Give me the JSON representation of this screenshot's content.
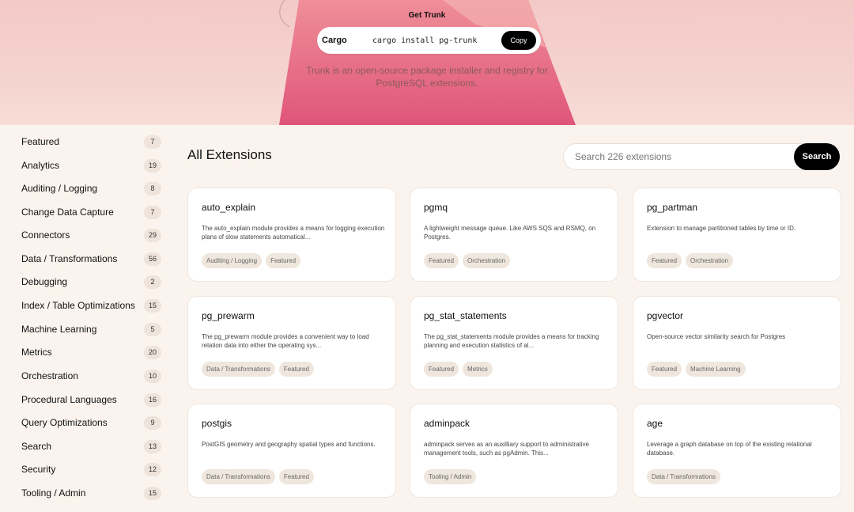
{
  "hero": {
    "heading": "Get Trunk",
    "package_manager": "Cargo",
    "command": "cargo install pg-trunk",
    "copy_label": "Copy",
    "tagline_line1": "Trunk is an open-source package installer and registry for",
    "tagline_line2": "PostgreSQL extensions."
  },
  "sidebar": {
    "categories": [
      {
        "label": "Featured",
        "count": "7"
      },
      {
        "label": "Analytics",
        "count": "19"
      },
      {
        "label": "Auditing / Logging",
        "count": "8"
      },
      {
        "label": "Change Data Capture",
        "count": "7"
      },
      {
        "label": "Connectors",
        "count": "29"
      },
      {
        "label": "Data / Transformations",
        "count": "56"
      },
      {
        "label": "Debugging",
        "count": "2"
      },
      {
        "label": "Index / Table Optimizations",
        "count": "15"
      },
      {
        "label": "Machine Learning",
        "count": "5"
      },
      {
        "label": "Metrics",
        "count": "20"
      },
      {
        "label": "Orchestration",
        "count": "10"
      },
      {
        "label": "Procedural Languages",
        "count": "16"
      },
      {
        "label": "Query Optimizations",
        "count": "9"
      },
      {
        "label": "Search",
        "count": "13"
      },
      {
        "label": "Security",
        "count": "12"
      },
      {
        "label": "Tooling / Admin",
        "count": "15"
      }
    ]
  },
  "main": {
    "title": "All Extensions",
    "search_placeholder": "Search 226 extensions",
    "search_button": "Search",
    "extensions": [
      {
        "name": "auto_explain",
        "description": "The auto_explain module provides a means for logging execution plans of slow statements automatical...",
        "tags": [
          "Auditing / Logging",
          "Featured"
        ]
      },
      {
        "name": "pgmq",
        "description": "A lightweight message queue. Like AWS SQS and RSMQ, on Postgres.",
        "tags": [
          "Featured",
          "Orchestration"
        ]
      },
      {
        "name": "pg_partman",
        "description": "Extension to manage partitioned tables by time or ID.",
        "tags": [
          "Featured",
          "Orchestration"
        ]
      },
      {
        "name": "pg_prewarm",
        "description": "The pg_prewarm module provides a convenient way to load relation data into either the operating sys...",
        "tags": [
          "Data / Transformations",
          "Featured"
        ]
      },
      {
        "name": "pg_stat_statements",
        "description": "The pg_stat_statements module provides a means for tracking planning and execution statistics of al...",
        "tags": [
          "Featured",
          "Metrics"
        ]
      },
      {
        "name": "pgvector",
        "description": "Open-source vector similarity search for Postgres",
        "tags": [
          "Featured",
          "Machine Learning"
        ]
      },
      {
        "name": "postgis",
        "description": "PostGIS geometry and geography spatial types and functions.",
        "tags": [
          "Data / Transformations",
          "Featured"
        ]
      },
      {
        "name": "adminpack",
        "description": "adminpack serves as an auxilliary support to administrative management tools, such as pgAdmin. This...",
        "tags": [
          "Tooling / Admin"
        ]
      },
      {
        "name": "age",
        "description": "Leverage a graph database on top of the existing relational database.",
        "tags": [
          "Data / Transformations"
        ]
      }
    ]
  },
  "colors": {
    "hero_pink": "#e0557a",
    "page_bg": "#fbf3ee",
    "accent_black": "#000000"
  }
}
